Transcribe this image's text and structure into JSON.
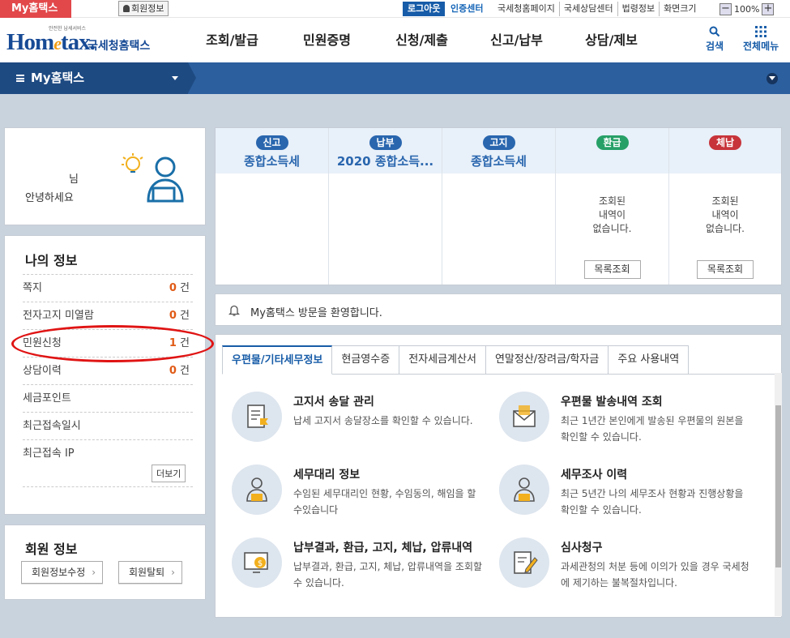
{
  "utilbar": {
    "myhome_tab": "My홈택스",
    "member_info": "회원정보",
    "logout": "로그아웃",
    "cert_center": "인증센터",
    "links": [
      "국세청홈페이지",
      "국세상담센터",
      "법령정보",
      "화면크기"
    ],
    "zoom_minus": "−",
    "zoom_value": "100%",
    "zoom_plus": "+"
  },
  "header": {
    "logo_small": "안전한 납세서비스",
    "logo_main_a": "Hom",
    "logo_main_e": "e",
    "logo_main_b": "tax.",
    "logo_kr": "국세청홈택스",
    "gnb": [
      "조회/발급",
      "민원증명",
      "신청/제출",
      "신고/납부",
      "상담/제보"
    ],
    "search_label": "검색",
    "allmenu_label": "전체메뉴"
  },
  "navbar": {
    "title": "My홈택스"
  },
  "greeting": {
    "name_suffix": "님",
    "hello": "안녕하세요"
  },
  "my_info": {
    "title": "나의 정보",
    "rows": [
      {
        "label": "쪽지",
        "count": "0",
        "unit": " 건"
      },
      {
        "label": "전자고지 미열람",
        "count": "0",
        "unit": " 건"
      },
      {
        "label": "민원신청",
        "count": "1",
        "unit": " 건"
      },
      {
        "label": "상담이력",
        "count": "0",
        "unit": " 건"
      },
      {
        "label": "세금포인트",
        "count": "",
        "unit": ""
      },
      {
        "label": "최근접속일시",
        "count": "",
        "unit": ""
      },
      {
        "label": "최근접속 IP",
        "count": "",
        "unit": ""
      }
    ],
    "more": "더보기"
  },
  "member_panel": {
    "title": "회원 정보",
    "edit": "회원정보수정",
    "withdraw": "회원탈퇴"
  },
  "status_board": {
    "columns": [
      {
        "badge": "신고",
        "title": "종합소득세"
      },
      {
        "badge": "납부",
        "title": "2020 종합소득..."
      },
      {
        "badge": "고지",
        "title": "종합소득세"
      },
      {
        "badge": "환급",
        "title": "",
        "empty": [
          "조회된",
          "내역이",
          "없습니다."
        ],
        "list_btn": "목록조회"
      },
      {
        "badge": "체납",
        "title": "",
        "empty": [
          "조회된",
          "내역이",
          "없습니다."
        ],
        "list_btn": "목록조회"
      }
    ]
  },
  "welcome": {
    "text": "My홈택스 방문을 환영합니다."
  },
  "tabs": [
    "우편물/기타세무정보",
    "현금영수증",
    "전자세금계산서",
    "연말정산/장려금/학자금",
    "주요 사용내역"
  ],
  "services": [
    {
      "title": "고지서 송달 관리",
      "desc": "납세 고지서 송달장소를 확인할 수 있습니다.",
      "icon": "document-icon"
    },
    {
      "title": "우편물 발송내역 조회",
      "desc": "최근 1년간 본인에게 발송된 우편물의 원본을 확인할 수 있습니다.",
      "icon": "envelope-icon"
    },
    {
      "title": "세무대리 정보",
      "desc": "수임된 세무대리인 현황, 수임동의, 해임을 할수있습니다",
      "icon": "person-laptop-icon"
    },
    {
      "title": "세무조사 이력",
      "desc": "최근 5년간 나의 세무조사 현황과 진행상황을 확인할 수 있습니다.",
      "icon": "person-laptop-icon"
    },
    {
      "title": "납부결과, 환급, 고지, 체납, 압류내역",
      "desc": "납부결과, 환급, 고지, 체납, 압류내역을 조회할 수 있습니다.",
      "icon": "money-screen-icon"
    },
    {
      "title": "심사청구",
      "desc": "과세관청의 처분 등에 이의가 있을 경우 국세청에 제기하는 불복절차입니다.",
      "icon": "pen-document-icon"
    }
  ],
  "colors": {
    "accent": "#175ca8",
    "navbar": "#2c5f9e",
    "count": "#e05a16",
    "oval": "#e01414"
  }
}
